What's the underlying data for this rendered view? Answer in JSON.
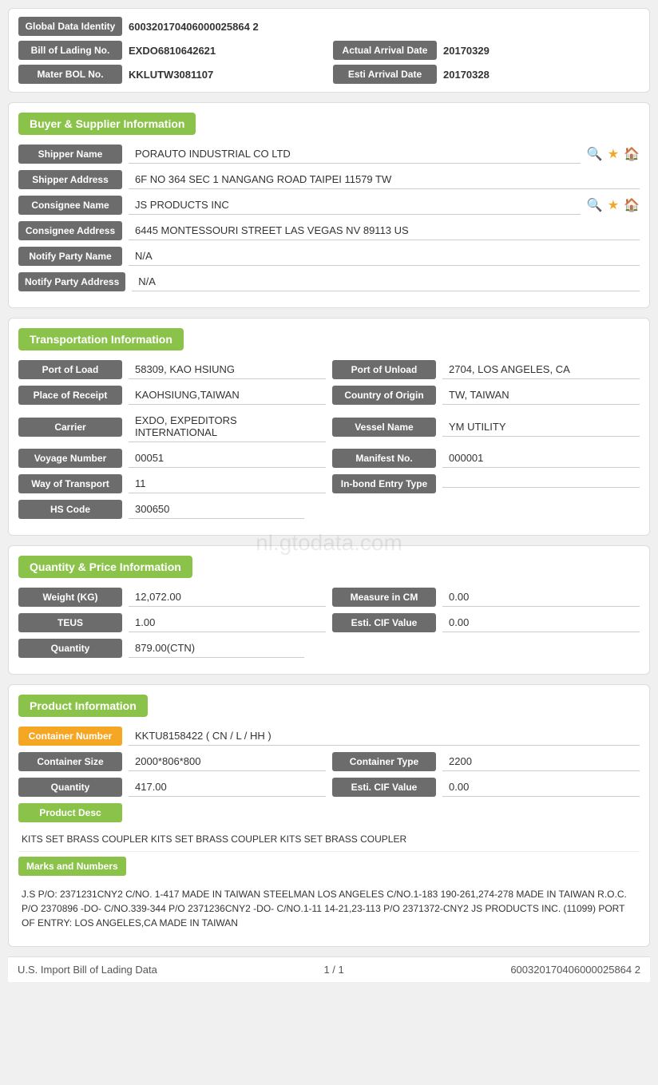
{
  "identity": {
    "global_data_label": "Global Data Identity",
    "global_data_value": "600320170406000025864 2",
    "bill_of_lading_label": "Bill of Lading No.",
    "bill_of_lading_value": "EXDO6810642621",
    "actual_arrival_label": "Actual Arrival Date",
    "actual_arrival_value": "20170329",
    "mater_bol_label": "Mater BOL No.",
    "mater_bol_value": "KKLUTW3081107",
    "esti_arrival_label": "Esti Arrival Date",
    "esti_arrival_value": "20170328"
  },
  "buyer_supplier": {
    "title": "Buyer & Supplier Information",
    "shipper_name_label": "Shipper Name",
    "shipper_name_value": "PORAUTO INDUSTRIAL CO LTD",
    "shipper_address_label": "Shipper Address",
    "shipper_address_value": "6F NO 364 SEC 1 NANGANG ROAD TAIPEI 11579 TW",
    "consignee_name_label": "Consignee Name",
    "consignee_name_value": "JS PRODUCTS INC",
    "consignee_address_label": "Consignee Address",
    "consignee_address_value": "6445 MONTESSOURI STREET LAS VEGAS NV 89113 US",
    "notify_party_name_label": "Notify Party Name",
    "notify_party_name_value": "N/A",
    "notify_party_address_label": "Notify Party Address",
    "notify_party_address_value": "N/A"
  },
  "transportation": {
    "title": "Transportation Information",
    "port_of_load_label": "Port of Load",
    "port_of_load_value": "58309, KAO HSIUNG",
    "port_of_unload_label": "Port of Unload",
    "port_of_unload_value": "2704, LOS ANGELES, CA",
    "place_of_receipt_label": "Place of Receipt",
    "place_of_receipt_value": "KAOHSIUNG,TAIWAN",
    "country_of_origin_label": "Country of Origin",
    "country_of_origin_value": "TW, TAIWAN",
    "carrier_label": "Carrier",
    "carrier_value": "EXDO, EXPEDITORS INTERNATIONAL",
    "vessel_name_label": "Vessel Name",
    "vessel_name_value": "YM UTILITY",
    "voyage_number_label": "Voyage Number",
    "voyage_number_value": "00051",
    "manifest_no_label": "Manifest No.",
    "manifest_no_value": "000001",
    "way_of_transport_label": "Way of Transport",
    "way_of_transport_value": "11",
    "inbond_entry_label": "In-bond Entry Type",
    "inbond_entry_value": "",
    "hs_code_label": "HS Code",
    "hs_code_value": "300650"
  },
  "quantity_price": {
    "title": "Quantity & Price Information",
    "weight_label": "Weight (KG)",
    "weight_value": "12,072.00",
    "measure_label": "Measure in CM",
    "measure_value": "0.00",
    "teus_label": "TEUS",
    "teus_value": "1.00",
    "esti_cif_label": "Esti. CIF Value",
    "esti_cif_value": "0.00",
    "quantity_label": "Quantity",
    "quantity_value": "879.00(CTN)"
  },
  "product_info": {
    "title": "Product Information",
    "container_number_label": "Container Number",
    "container_number_value": "KKTU8158422 ( CN / L / HH )",
    "container_size_label": "Container Size",
    "container_size_value": "2000*806*800",
    "container_type_label": "Container Type",
    "container_type_value": "2200",
    "quantity_label": "Quantity",
    "quantity_value": "417.00",
    "esti_cif_label": "Esti. CIF Value",
    "esti_cif_value": "0.00",
    "product_desc_label": "Product Desc",
    "product_desc_value": "KITS SET BRASS COUPLER KITS SET BRASS COUPLER KITS SET BRASS COUPLER",
    "marks_label": "Marks and Numbers",
    "marks_value": "J.S P/O: 2371231CNY2 C/NO. 1-417 MADE IN TAIWAN STEELMAN LOS ANGELES C/NO.1-183 190-261,274-278 MADE IN TAIWAN R.O.C. P/O 2370896 -DO- C/NO.339-344 P/O 2371236CNY2 -DO- C/NO.1-11 14-21,23-113 P/O 2371372-CNY2 JS PRODUCTS INC. (11099) PORT OF ENTRY: LOS ANGELES,CA MADE IN TAIWAN"
  },
  "footer": {
    "left": "U.S. Import Bill of Lading Data",
    "center": "1 / 1",
    "right": "600320170406000025864 2"
  },
  "watermark": "nl.gtodata.com"
}
